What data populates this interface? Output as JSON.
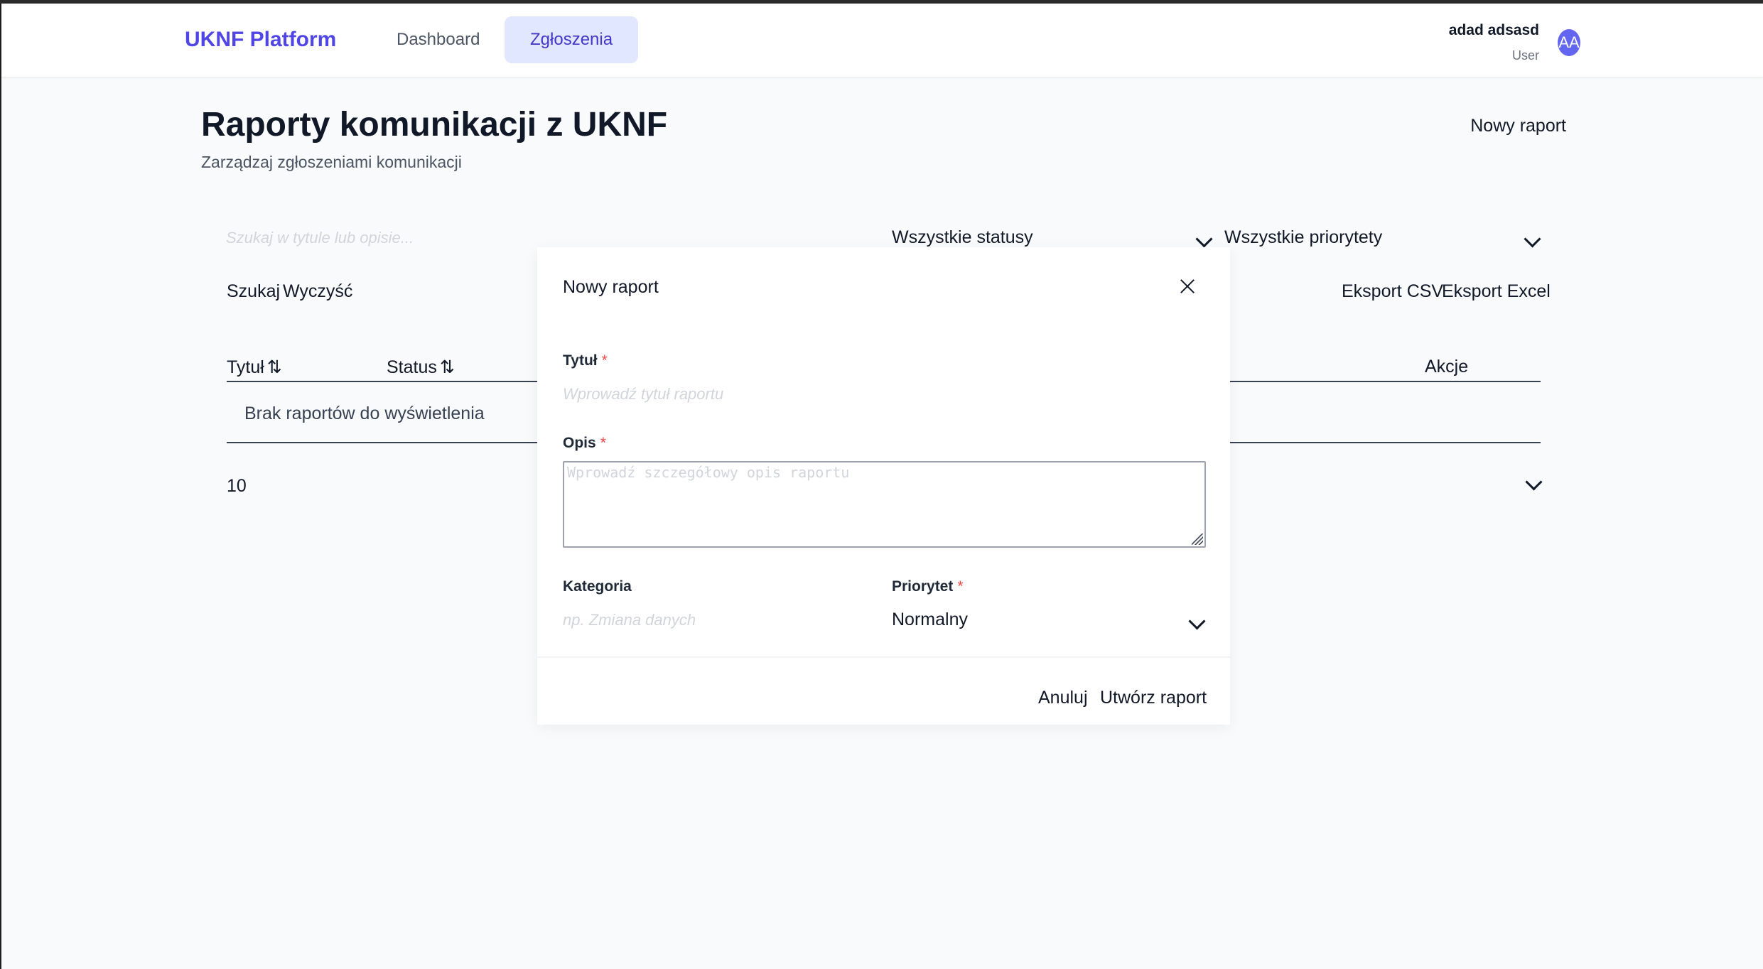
{
  "header": {
    "brand": "UKNF Platform",
    "nav": [
      {
        "label": "Dashboard",
        "active": false
      },
      {
        "label": "Zgłoszenia",
        "active": true
      }
    ],
    "user": {
      "name": "adad adsasd",
      "role": "User",
      "initials": "AA"
    }
  },
  "page": {
    "title": "Raporty komunikacji z UKNF",
    "subtitle": "Zarządzaj zgłoszeniami komunikacji",
    "new_report_label": "Nowy raport"
  },
  "filters": {
    "search_placeholder": "Szukaj w tytule lub opisie...",
    "status_selected": "Wszystkie statusy",
    "priority_selected": "Wszystkie priorytety",
    "search_label": "Szukaj",
    "clear_label": "Wyczyść",
    "export_csv_label": "Eksport CSV",
    "export_excel_label": "Eksport Excel"
  },
  "table": {
    "columns": {
      "title": "Tytuł",
      "status": "Status",
      "actions": "Akcje"
    },
    "sort_icon": "⇅",
    "empty_message": "Brak raportów do wyświetlenia"
  },
  "pagination": {
    "page_size": "10"
  },
  "modal": {
    "title": "Nowy raport",
    "fields": {
      "title": {
        "label": "Tytuł",
        "required": "*",
        "placeholder": "Wprowadź tytuł raportu"
      },
      "description": {
        "label": "Opis",
        "required": "*",
        "placeholder": "Wprowadź szczegółowy opis raportu"
      },
      "category": {
        "label": "Kategoria",
        "placeholder": "np. Zmiana danych"
      },
      "priority": {
        "label": "Priorytet",
        "required": "*",
        "selected": "Normalny"
      }
    },
    "cancel_label": "Anuluj",
    "create_label": "Utwórz raport"
  },
  "colors": {
    "brand": "#4f46e5",
    "active_tab_bg": "#e0e7ff",
    "avatar": "#6366f1",
    "required": "#ef4444"
  }
}
